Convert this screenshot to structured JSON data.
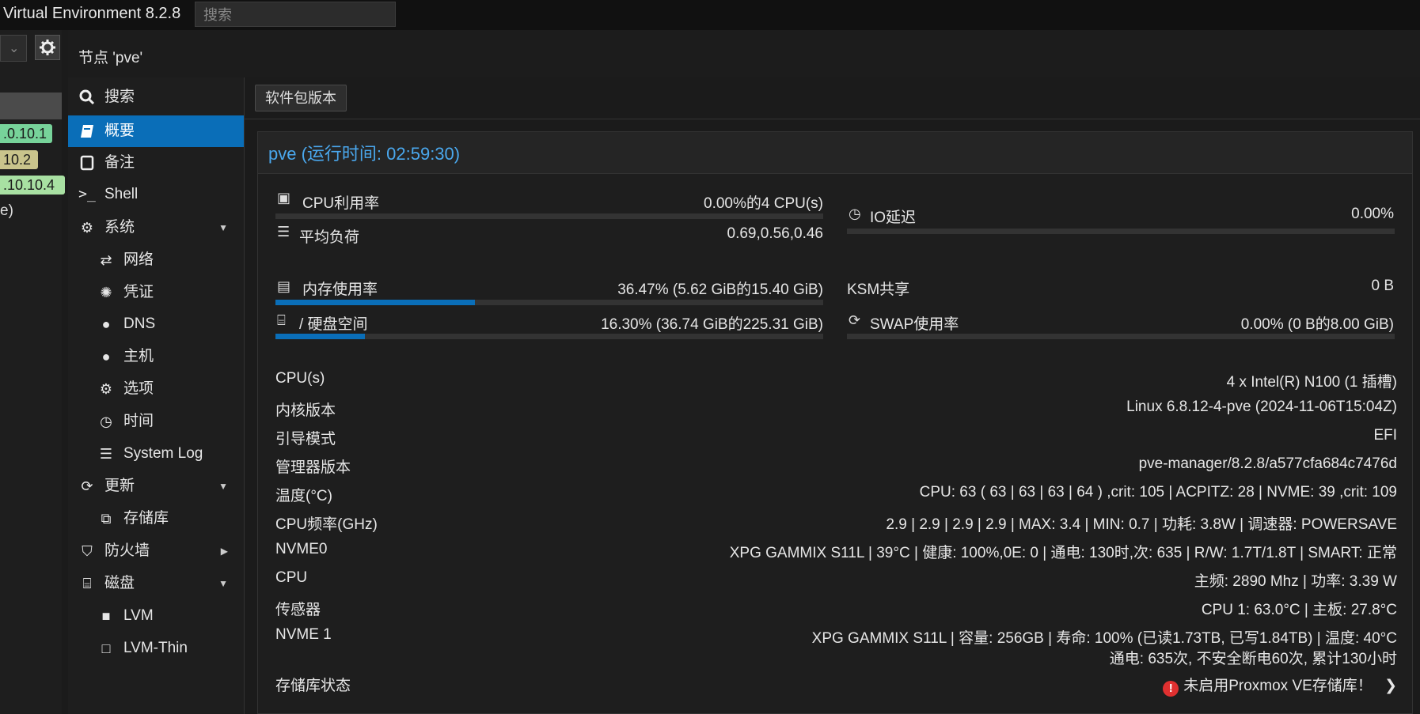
{
  "topbar": {
    "title": "Virtual Environment 8.2.8",
    "search_placeholder": "搜索"
  },
  "tree": {
    "tags": [
      ".0.10.1",
      "10.2",
      ".10.10.4"
    ],
    "partial_text": "e)"
  },
  "node": {
    "title": "节点 'pve'"
  },
  "nav": {
    "items": [
      {
        "label": "搜索",
        "icon": "search-icon"
      },
      {
        "label": "概要",
        "icon": "book-icon",
        "active": true
      },
      {
        "label": "备注",
        "icon": "note-icon"
      },
      {
        "label": "Shell",
        "icon": "terminal-icon"
      },
      {
        "label": "系统",
        "icon": "cogs-icon",
        "expanded": true
      },
      {
        "label": "网络",
        "icon": "exchange-icon"
      },
      {
        "label": "凭证",
        "icon": "certificate-icon"
      },
      {
        "label": "DNS",
        "icon": "globe-icon"
      },
      {
        "label": "主机",
        "icon": "globe-icon"
      },
      {
        "label": "选项",
        "icon": "gear-icon"
      },
      {
        "label": "时间",
        "icon": "clock-icon"
      },
      {
        "label": "System Log",
        "icon": "list-icon"
      },
      {
        "label": "更新",
        "icon": "refresh-icon",
        "expanded": true
      },
      {
        "label": "存储库",
        "icon": "copy-icon"
      },
      {
        "label": "防火墙",
        "icon": "shield-icon",
        "expanded": false
      },
      {
        "label": "磁盘",
        "icon": "hdd-icon",
        "expanded": true
      },
      {
        "label": "LVM",
        "icon": "square-icon"
      },
      {
        "label": "LVM-Thin",
        "icon": "square-outline-icon"
      }
    ]
  },
  "toolbar": {
    "packages_button": "软件包版本"
  },
  "panel": {
    "title": "pve (运行时间: 02:59:30)"
  },
  "stats": {
    "cpu": {
      "label": "CPU利用率",
      "value": "0.00%的4 CPU(s)",
      "percent": 0.0
    },
    "load": {
      "label": "平均负荷",
      "value": "0.69,0.56,0.46"
    },
    "io": {
      "label": "IO延迟",
      "value": "0.00%",
      "percent": 0.0
    },
    "mem": {
      "label": "内存使用率",
      "value": "36.47% (5.62 GiB的15.40 GiB)",
      "percent": 36.47
    },
    "ksm": {
      "label": "KSM共享",
      "value": "0 B"
    },
    "disk": {
      "label": "/ 硬盘空间",
      "value": "16.30% (36.74 GiB的225.31 GiB)",
      "percent": 16.3
    },
    "swap": {
      "label": "SWAP使用率",
      "value": "0.00% (0 B的8.00 GiB)",
      "percent": 0.0
    }
  },
  "info": [
    {
      "label": "CPU(s)",
      "value": "4 x Intel(R) N100 (1 插槽)"
    },
    {
      "label": "内核版本",
      "value": "Linux 6.8.12-4-pve (2024-11-06T15:04Z)"
    },
    {
      "label": "引导模式",
      "value": "EFI"
    },
    {
      "label": "管理器版本",
      "value": "pve-manager/8.2.8/a577cfa684c7476d"
    },
    {
      "label": "温度(°C)",
      "value": "CPU: 63 ( 63 | 63 | 63 | 64 ) ,crit: 105 | ACPITZ: 28 | NVME: 39 ,crit: 109"
    },
    {
      "label": "CPU频率(GHz)",
      "value": "2.9 | 2.9 | 2.9 | 2.9 | MAX: 3.4 | MIN: 0.7 | 功耗: 3.8W | 调速器: POWERSAVE"
    },
    {
      "label": "NVME0",
      "value": "XPG GAMMIX S11L | 39°C | 健康: 100%,0E: 0 | 通电: 130时,次: 635 | R/W: 1.7T/1.8T | SMART: 正常"
    },
    {
      "label": "CPU",
      "value": "主频: 2890 Mhz | 功率: 3.39 W"
    },
    {
      "label": "传感器",
      "value": "CPU 1: 63.0°C | 主板: 27.8°C"
    },
    {
      "label": "NVME 1",
      "value": "XPG GAMMIX S11L | 容量: 256GB | 寿命: 100% (已读1.73TB, 已写1.84TB) | 温度: 40°C",
      "value2": "通电: 635次, 不安全断电60次, 累计130小时"
    },
    {
      "label": "存储库状态",
      "value": "未启用Proxmox VE存储库！"
    }
  ]
}
